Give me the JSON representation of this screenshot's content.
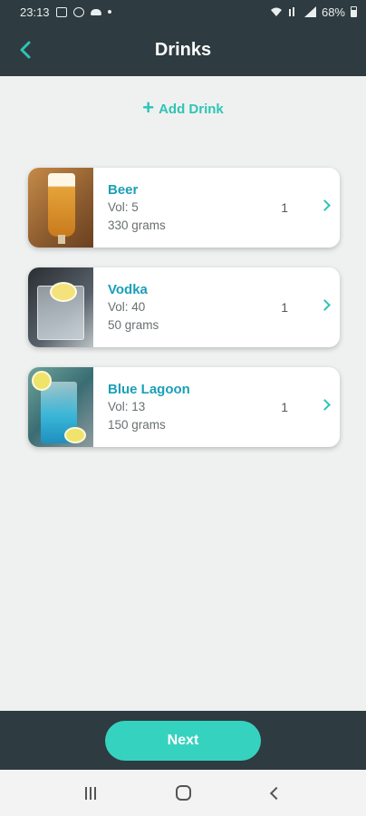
{
  "status_bar": {
    "time": "23:13",
    "battery": "68%"
  },
  "header": {
    "title": "Drinks"
  },
  "add_drink": {
    "label": "Add Drink"
  },
  "drinks": [
    {
      "name": "Beer",
      "vol": "Vol: 5",
      "weight": "330 grams",
      "qty": "1",
      "image": "beer"
    },
    {
      "name": "Vodka",
      "vol": "Vol: 40",
      "weight": "50 grams",
      "qty": "1",
      "image": "vodka"
    },
    {
      "name": "Blue Lagoon",
      "vol": "Vol: 13",
      "weight": "150 grams",
      "qty": "1",
      "image": "blue-lagoon"
    }
  ],
  "footer": {
    "next_label": "Next"
  },
  "colors": {
    "accent": "#2ec4b6",
    "header_bg": "#2e3b40",
    "drink_name": "#1a9fb8",
    "button": "#36d2c0"
  }
}
